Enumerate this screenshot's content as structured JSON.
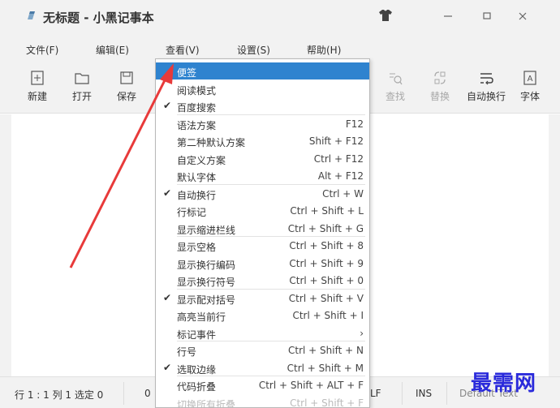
{
  "window": {
    "title": "无标题 - 小黑记事本",
    "icons": [
      "pen-icon",
      "shirt-icon",
      "minimize-icon",
      "maximize-icon",
      "close-icon"
    ]
  },
  "menubar": {
    "file": "文件(F)",
    "edit": "编辑(E)",
    "view": "查看(V)",
    "settings": "设置(S)",
    "help": "帮助(H)"
  },
  "toolbar": {
    "new": "新建",
    "open": "打开",
    "save": "保存",
    "find": "查找",
    "replace": "替换",
    "wrap": "自动换行",
    "font": "字体"
  },
  "view_menu": {
    "items": [
      {
        "label": "便签",
        "shortcut": "",
        "checked": false,
        "highlighted": true
      },
      {
        "label": "阅读模式",
        "shortcut": "",
        "checked": false
      },
      {
        "label": "百度搜索",
        "shortcut": "",
        "checked": true
      },
      {
        "label": "语法方案",
        "shortcut": "F12",
        "checked": false
      },
      {
        "label": "第二种默认方案",
        "shortcut": "Shift + F12",
        "checked": false
      },
      {
        "label": "自定义方案",
        "shortcut": "Ctrl + F12",
        "checked": false
      },
      {
        "label": "默认字体",
        "shortcut": "Alt + F12",
        "checked": false
      },
      {
        "label": "自动换行",
        "shortcut": "Ctrl + W",
        "checked": true
      },
      {
        "label": "行标记",
        "shortcut": "Ctrl + Shift + L",
        "checked": false
      },
      {
        "label": "显示缩进栏线",
        "shortcut": "Ctrl + Shift + G",
        "checked": false
      },
      {
        "label": "显示空格",
        "shortcut": "Ctrl + Shift + 8",
        "checked": false
      },
      {
        "label": "显示换行编码",
        "shortcut": "Ctrl + Shift + 9",
        "checked": false
      },
      {
        "label": "显示换行符号",
        "shortcut": "Ctrl + Shift + 0",
        "checked": false
      },
      {
        "label": "显示配对括号",
        "shortcut": "Ctrl + Shift + V",
        "checked": true
      },
      {
        "label": "高亮当前行",
        "shortcut": "Ctrl + Shift + I",
        "checked": false
      },
      {
        "label": "标记事件",
        "shortcut": "›",
        "checked": false
      },
      {
        "label": "行号",
        "shortcut": "Ctrl + Shift + N",
        "checked": false
      },
      {
        "label": "选取边缘",
        "shortcut": "Ctrl + Shift + M",
        "checked": true
      },
      {
        "label": "代码折叠",
        "shortcut": "Ctrl + Shift + ALT + F",
        "checked": false
      },
      {
        "label": "切换所有折叠",
        "shortcut": "Ctrl + Shift + F",
        "checked": false
      }
    ]
  },
  "statusbar": {
    "position": "行 1 : 1   列 1   选定 0",
    "encoding_partial": "0",
    "eol": "LF",
    "mode": "INS",
    "theme": "Default Text"
  },
  "watermark": "最需网",
  "colors": {
    "highlight": "#2f83cf",
    "arrow": "#e83a3a",
    "watermark": "#2a2adb",
    "chrome": "#f2f2f2"
  }
}
